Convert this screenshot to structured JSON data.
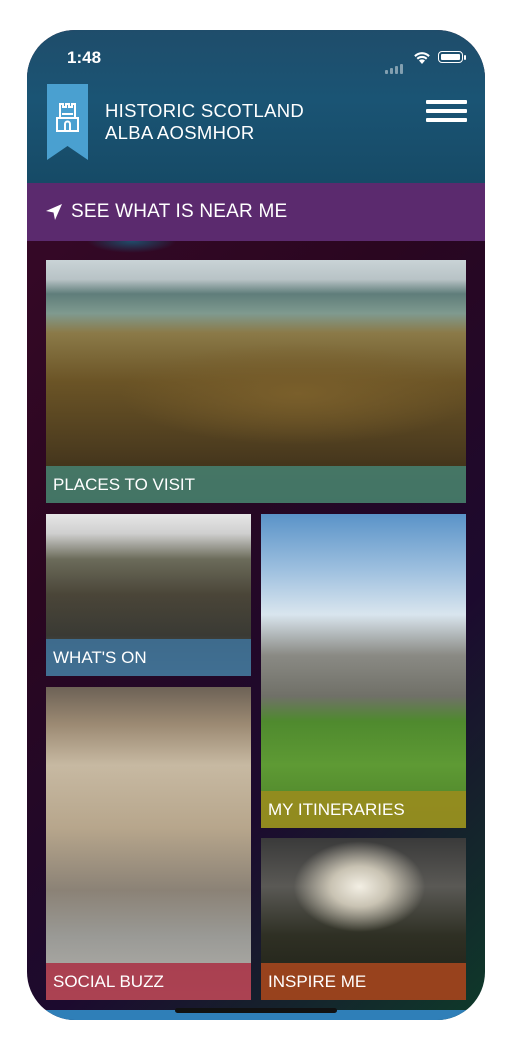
{
  "status_bar": {
    "time": "1:48"
  },
  "header": {
    "brand_line1": "HISTORIC SCOTLAND",
    "brand_line2": "ALBA AOSMHOR",
    "menu_icon": "hamburger-menu-icon",
    "logo_icon": "castle-bookmark-icon"
  },
  "near_me": {
    "label": "SEE WHAT IS NEAR ME",
    "icon": "location-arrow-icon"
  },
  "tiles": [
    {
      "label": "PLACES TO VISIT",
      "color": "#467d6e"
    },
    {
      "label": "WHAT'S ON",
      "color": "#3e7096"
    },
    {
      "label": "MY ITINERARIES",
      "color": "#9b8c1e"
    },
    {
      "label": "SOCIAL BUZZ",
      "color": "#aa3246"
    },
    {
      "label": "INSPIRE ME",
      "color": "#a5461e"
    }
  ],
  "colors": {
    "header": "#1a5474",
    "near_me_bar": "#5b2a6e",
    "ribbon": "#4aa0d0"
  }
}
